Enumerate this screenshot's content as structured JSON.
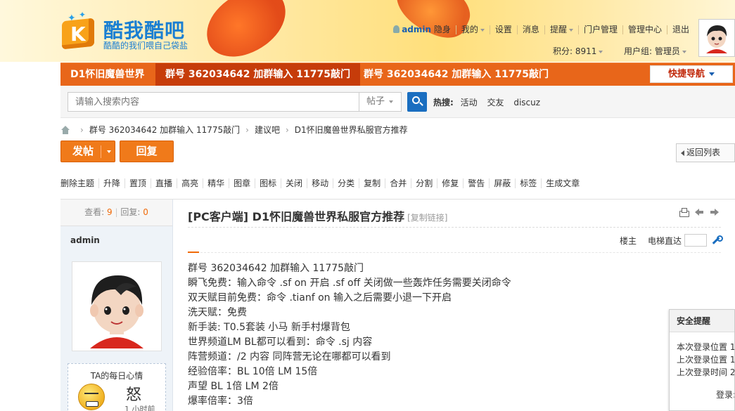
{
  "site": {
    "title": "酷我酷吧",
    "slogan": "酷酷的我们喂自己袋盐"
  },
  "topnav": {
    "username": "admin",
    "invisible": "隐身",
    "items": [
      "我的",
      "设置",
      "消息",
      "提醒",
      "门户管理",
      "管理中心",
      "退出"
    ],
    "points_label": "积分: 8911",
    "group_label": "用户组: 管理员"
  },
  "nav": {
    "tabs": [
      "D1怀旧魔兽世界",
      "群号 362034642 加群输入 11775敲门",
      "群号 362034642 加群输入 11775敲门"
    ],
    "quick_nav": "快捷导航"
  },
  "search": {
    "placeholder": "请输入搜索内容",
    "type": "帖子",
    "hot_label": "热搜:",
    "hot_items": [
      "活动",
      "交友",
      "discuz"
    ]
  },
  "breadcrumb": [
    "群号 362034642 加群输入 11775敲门",
    "建议吧",
    "D1怀旧魔兽世界私服官方推荐"
  ],
  "buttons": {
    "post": "发帖",
    "reply": "回复",
    "back": "返回列表"
  },
  "mod_actions": [
    "删除主题",
    "升降",
    "置顶",
    "直播",
    "高亮",
    "精华",
    "图章",
    "图标",
    "关闭",
    "移动",
    "分类",
    "复制",
    "合并",
    "分割",
    "修复",
    "警告",
    "屏蔽",
    "标签",
    "生成文章"
  ],
  "side": {
    "views_label": "查看:",
    "views": "9",
    "replies_label": "回复:",
    "replies": "0",
    "author": "admin",
    "mood_title": "TA的每日心情",
    "mood_word": "怒",
    "mood_sub": "1 小时前"
  },
  "post": {
    "title": "[PC客户端] D1怀旧魔兽世界私服官方推荐",
    "copy_link": "[复制链接]",
    "owner": "楼主",
    "elevator": "电梯直达",
    "lines": [
      "群号 362034642 加群输入 11775敲门",
      "瞬飞免费：输入命令 .sf on 开启 .sf off 关闭做一些轰炸任务需要关闭命令",
      "双天赋目前免费：命令 .tianf on 输入之后需要小退一下开启",
      "洗天赋：免费",
      "新手装: T0.5套装 小马 新手村爆背包",
      "世界频道LM BL都可以看到：命令 .sj 内容",
      "阵营频道：/2 内容 同阵营无论在哪都可以看到",
      "经验倍率：BL 10倍  LM 15倍",
      "声望 BL 1倍 LM 2倍",
      "爆率倍率：3倍"
    ]
  },
  "security": {
    "title": "安全提醒",
    "rows": [
      "本次登录位置 1",
      "上次登录位置 1",
      "上次登录时间 2"
    ],
    "login": "登录:"
  },
  "colors": {
    "nav_orange": "#e8661a",
    "brand_blue": "#1a7fd2",
    "button_orange": "#f07a1a"
  }
}
